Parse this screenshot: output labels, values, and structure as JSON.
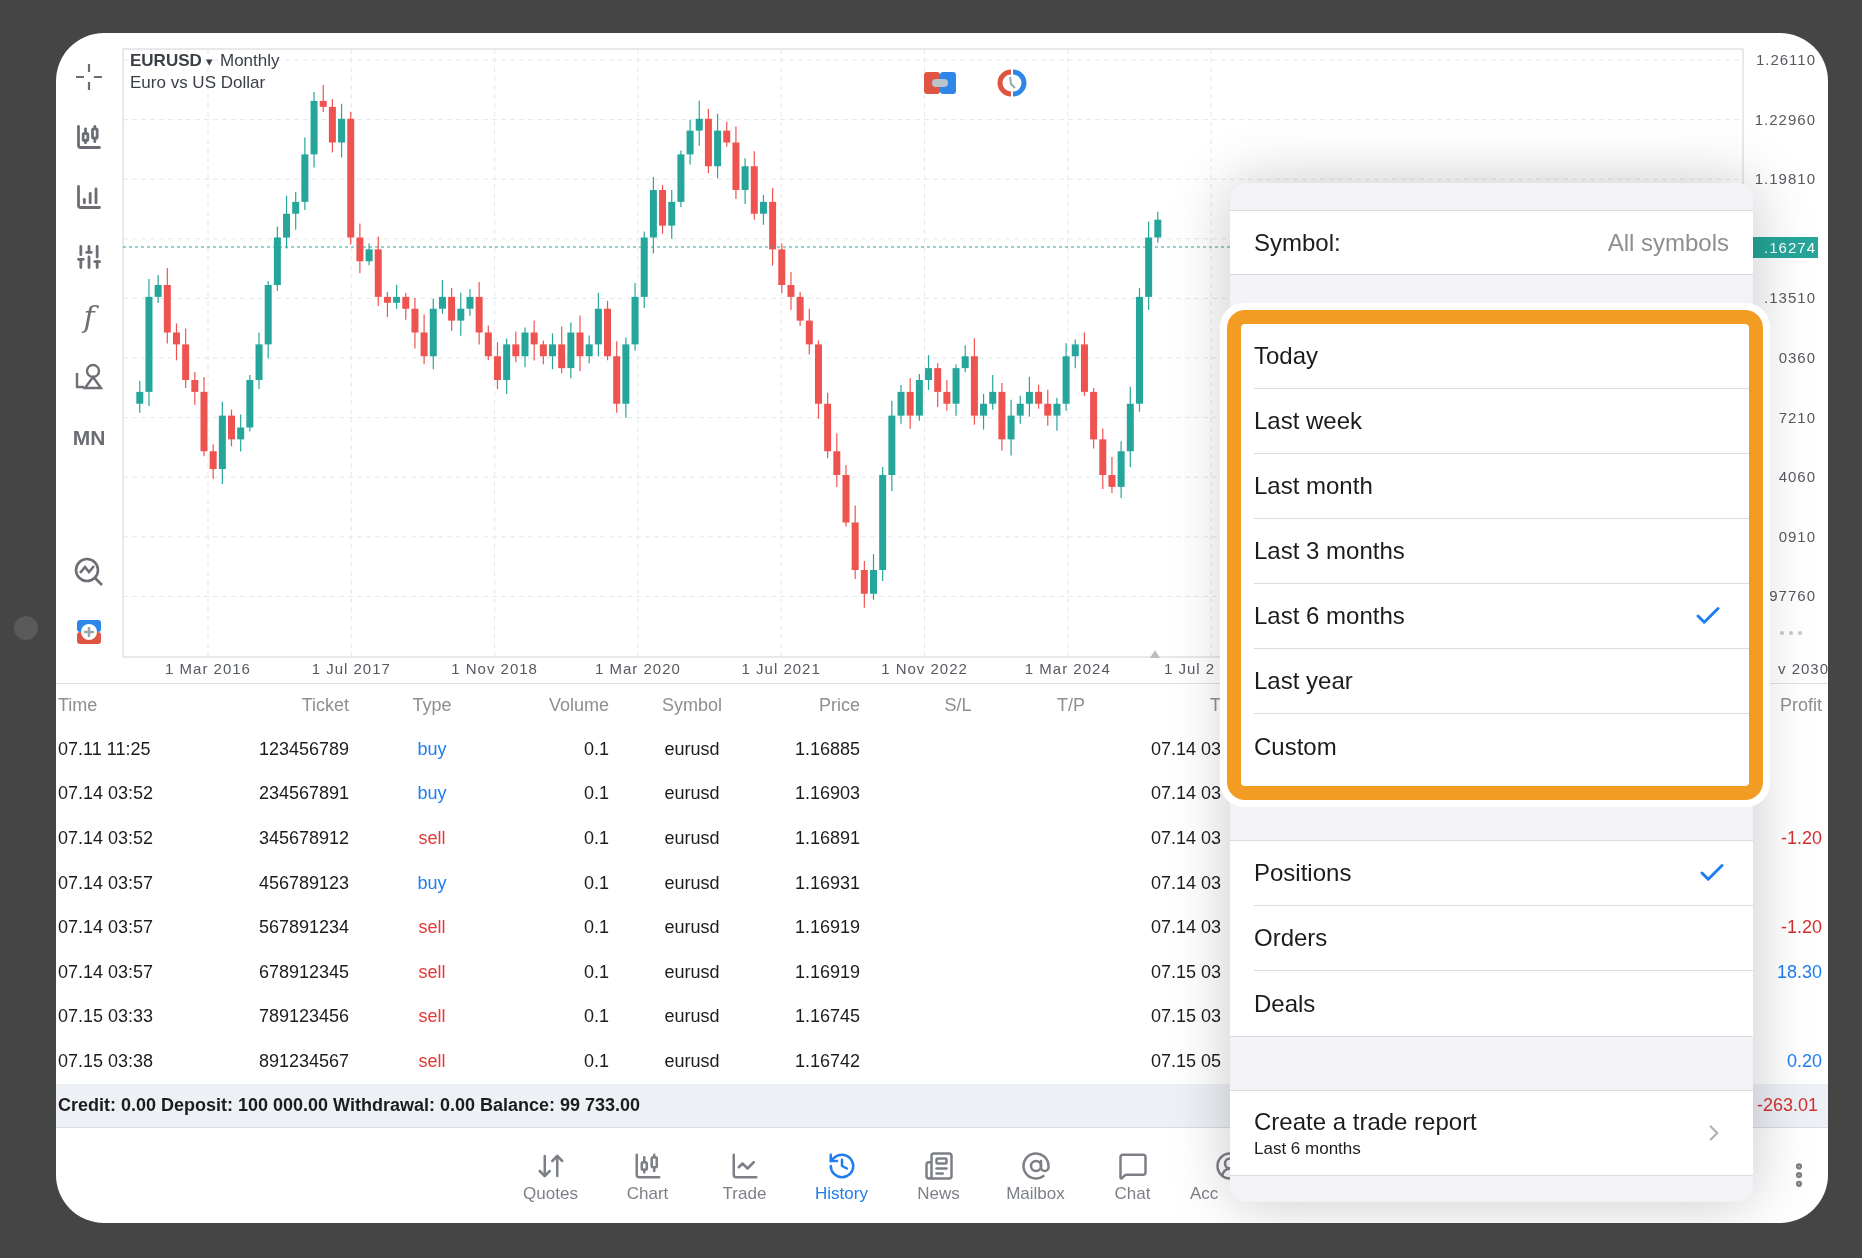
{
  "toolbar": {
    "function_glyph": "f",
    "timeframe": "MN"
  },
  "chart": {
    "symbol": "EURUSD",
    "symbol_caret": "▾",
    "timeframe": "Monthly",
    "description": "Euro vs US Dollar",
    "price_labels": [
      "1.26110",
      "1.22960",
      "1.19810",
      ".13510",
      "0360",
      "7210",
      "4060",
      "0910",
      "97760"
    ],
    "current_price": ".16274",
    "date_labels": [
      "1 Mar 2016",
      "1 Jul 2017",
      "1 Nov 2018",
      "1 Mar 2020",
      "1 Jul 2021",
      "1 Nov 2022",
      "1 Mar 2024",
      "1 Jul 2",
      "v 2030"
    ]
  },
  "table": {
    "columns": [
      "Time",
      "Ticket",
      "Type",
      "Volume",
      "Symbol",
      "Price",
      "S/L",
      "T/P",
      "T",
      "Profit"
    ],
    "rows": [
      {
        "time": "07.11 11:25",
        "ticket": "123456789",
        "type": "buy",
        "kind": "buy",
        "volume": "0.1",
        "symbol": "eurusd",
        "price": "1.16885",
        "close_time": "07.14 03"
      },
      {
        "time": "07.14 03:52",
        "ticket": "234567891",
        "type": "buy",
        "kind": "buy",
        "volume": "0.1",
        "symbol": "eurusd",
        "price": "1.16903",
        "close_time": "07.14 03"
      },
      {
        "time": "07.14 03:52",
        "ticket": "345678912",
        "type": "sell",
        "kind": "sell",
        "volume": "0.1",
        "symbol": "eurusd",
        "price": "1.16891",
        "close_time": "07.14 03",
        "profit": {
          "value": "-1.20",
          "kind": "loss"
        }
      },
      {
        "time": "07.14 03:57",
        "ticket": "456789123",
        "type": "buy",
        "kind": "buy",
        "volume": "0.1",
        "symbol": "eurusd",
        "price": "1.16931",
        "close_time": "07.14 03"
      },
      {
        "time": "07.14 03:57",
        "ticket": "567891234",
        "type": "sell",
        "kind": "sell",
        "volume": "0.1",
        "symbol": "eurusd",
        "price": "1.16919",
        "close_time": "07.14 03",
        "profit": {
          "value": "-1.20",
          "kind": "loss"
        }
      },
      {
        "time": "07.14 03:57",
        "ticket": "678912345",
        "type": "sell",
        "kind": "sell",
        "volume": "0.1",
        "symbol": "eurusd",
        "price": "1.16919",
        "close_time": "07.15 03",
        "profit": {
          "value": "18.30",
          "kind": "gain"
        }
      },
      {
        "time": "07.15 03:33",
        "ticket": "789123456",
        "type": "sell",
        "kind": "sell",
        "volume": "0.1",
        "symbol": "eurusd",
        "price": "1.16745",
        "close_time": "07.15 03"
      },
      {
        "time": "07.15 03:38",
        "ticket": "891234567",
        "type": "sell",
        "kind": "sell",
        "volume": "0.1",
        "symbol": "eurusd",
        "price": "1.16742",
        "close_time": "07.15 05",
        "profit": {
          "value": "0.20",
          "kind": "gain"
        }
      }
    ],
    "summary": "Credit: 0.00 Deposit: 100 000.00 Withdrawal: 0.00 Balance: 99 733.00",
    "total_profit": {
      "value": "-263.01",
      "kind": "loss"
    }
  },
  "nav": [
    {
      "label": "Quotes",
      "selected": false
    },
    {
      "label": "Chart",
      "selected": false
    },
    {
      "label": "Trade",
      "selected": false
    },
    {
      "label": "History",
      "selected": true
    },
    {
      "label": "News",
      "selected": false
    },
    {
      "label": "Mailbox",
      "selected": false
    },
    {
      "label": "Chat",
      "selected": false
    },
    {
      "label": "Acc",
      "selected": false
    }
  ],
  "popover": {
    "symbol_filter": {
      "label": "Symbol:",
      "value": "All symbols"
    },
    "periods": [
      {
        "label": "Today",
        "selected": false
      },
      {
        "label": "Last week",
        "selected": false
      },
      {
        "label": "Last month",
        "selected": false
      },
      {
        "label": "Last 3 months",
        "selected": false
      },
      {
        "label": "Last 6 months",
        "selected": true
      },
      {
        "label": "Last year",
        "selected": false
      },
      {
        "label": "Custom",
        "selected": false
      }
    ],
    "history_types": [
      {
        "label": "Positions",
        "selected": true
      },
      {
        "label": "Orders",
        "selected": false
      },
      {
        "label": "Deals",
        "selected": false
      }
    ],
    "report": {
      "title": "Create a trade report",
      "subtitle": "Last 6 months"
    }
  }
}
